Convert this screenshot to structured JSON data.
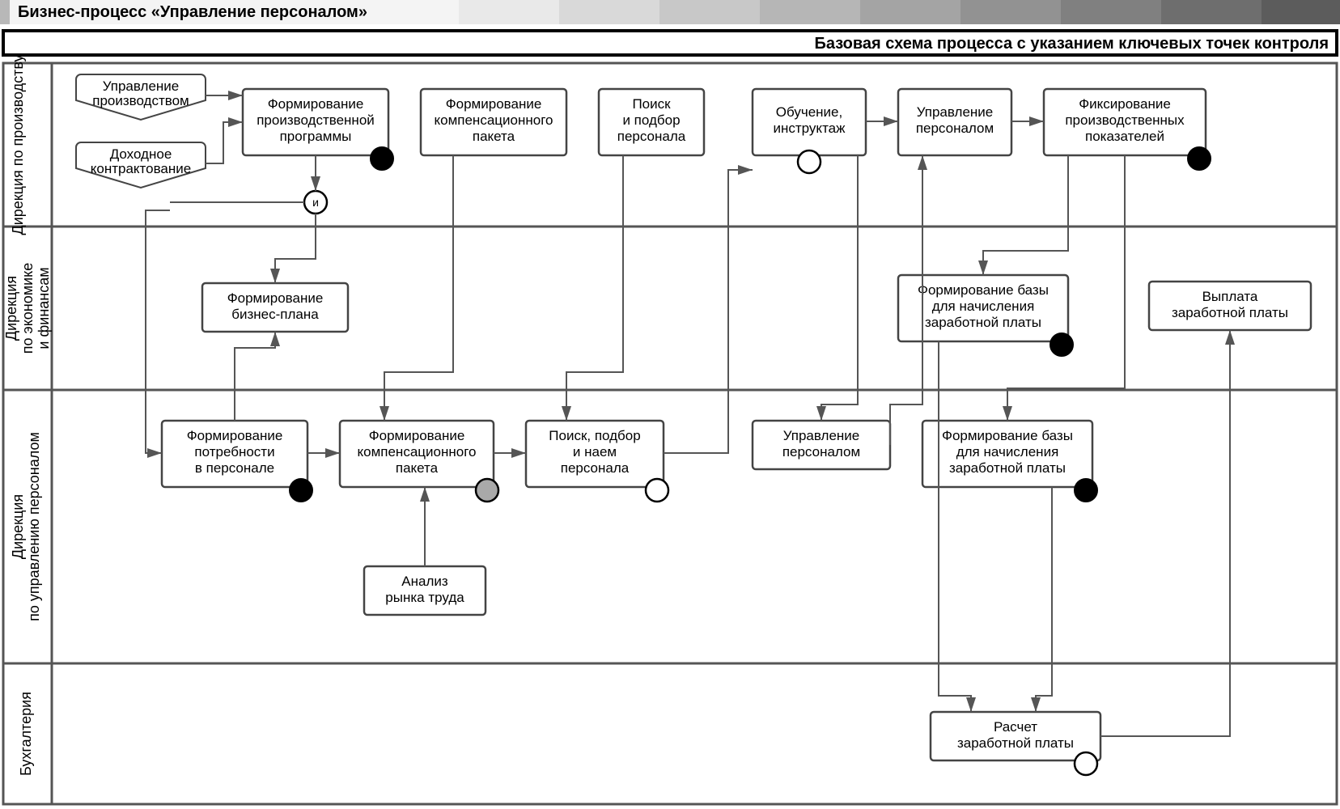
{
  "header": {
    "title": "Бизнес-процесс «Управление персоналом»",
    "subtitle": "Базовая схема процесса с указанием ключевых точек контроля"
  },
  "lanes": [
    {
      "id": "lane1",
      "label": "Дирекция\nпо производству"
    },
    {
      "id": "lane2",
      "label": "Дирекция\nпо экономике\nи финансам"
    },
    {
      "id": "lane3",
      "label": "Дирекция\nпо управлению персоналом"
    },
    {
      "id": "lane4",
      "label": "Бухгалтерия"
    }
  ],
  "inputs": {
    "in1": "Управление\nпроизводством",
    "in2": "Доходное\nконтрактование"
  },
  "boxes": {
    "b_prog": "Формирование\nпроизводственной\nпрограммы",
    "b_comp1": "Формирование\nкомпенсационного\nпакета",
    "b_search1": "Поиск\nи подбор\nперсонала",
    "b_train": "Обучение,\nинструктаж",
    "b_mgmt1": "Управление\nперсоналом",
    "b_fix": "Фиксирование\nпроизводственных\nпоказателей",
    "b_bplan": "Формирование\nбизнес-плана",
    "b_base1": "Формирование базы\nдля начисления\nзаработной платы",
    "b_payout": "Выплата\nзаработной платы",
    "b_need": "Формирование\nпотребности\nв персонале",
    "b_comp2": "Формирование\nкомпенсационного\nпакета",
    "b_search2": "Поиск, подбор\nи наем\nперсонала",
    "b_mgmt2": "Управление\nперсоналом",
    "b_base2": "Формирование базы\nдля начисления\nзаработной платы",
    "b_market": "Анализ\nрынка труда",
    "b_calc": "Расчет\nзаработной платы"
  },
  "gateway": {
    "and": "и"
  }
}
